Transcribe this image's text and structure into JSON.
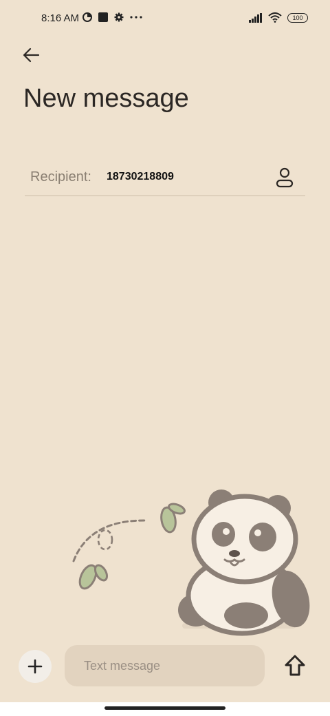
{
  "status_bar": {
    "time": "8:16 AM",
    "battery": "100",
    "icons": [
      "data-saver-icon",
      "stop-icon",
      "gear-icon",
      "more-dots-icon",
      "signal-icon",
      "wifi-icon",
      "battery-icon"
    ]
  },
  "header": {
    "title": "New message"
  },
  "recipient": {
    "label": "Recipient:",
    "value": "18730218809"
  },
  "composer": {
    "placeholder": "Text message"
  },
  "colors": {
    "background": "#efe2cf",
    "input_bg": "#e2d3bf",
    "panda_dark": "#8b7f76",
    "leaf": "#b8c49a"
  }
}
